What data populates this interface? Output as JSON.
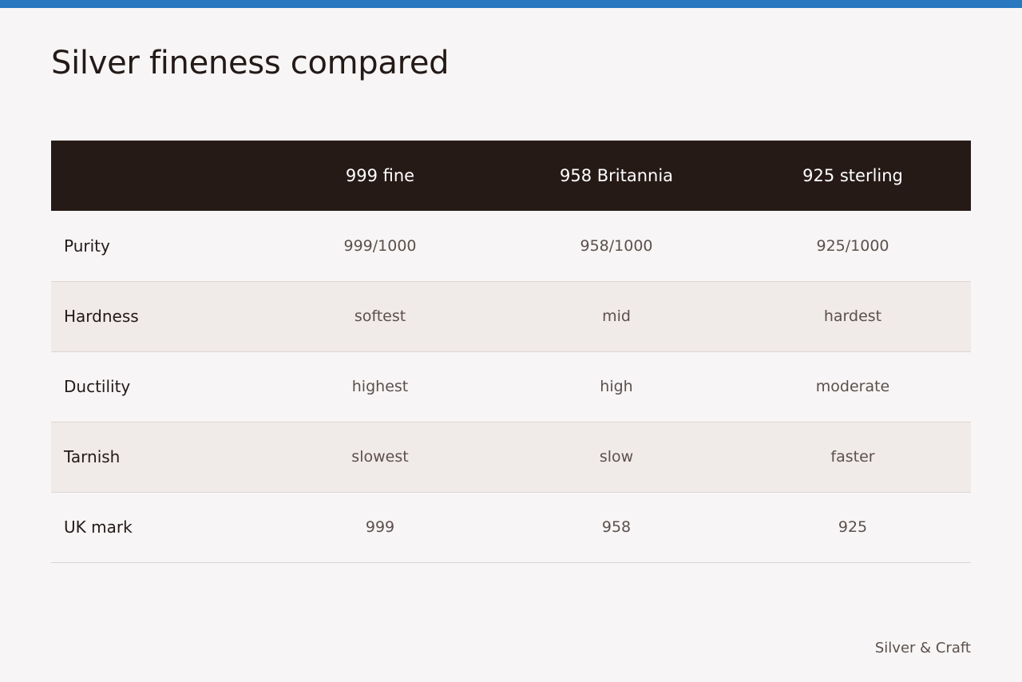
{
  "colors": {
    "accent_bar": "#2878bf",
    "header_bg": "#261a17",
    "alt_row_bg": "#f0eae9",
    "page_bg": "#f7f5f5"
  },
  "title": "Silver fineness compared",
  "table": {
    "headers": [
      "",
      "999 fine",
      "958 Britannia",
      "925 sterling"
    ],
    "rows": [
      {
        "label": "Purity",
        "values": [
          "999/1000",
          "958/1000",
          "925/1000"
        ]
      },
      {
        "label": "Hardness",
        "values": [
          "softest",
          "mid",
          "hardest"
        ]
      },
      {
        "label": "Ductility",
        "values": [
          "highest",
          "high",
          "moderate"
        ]
      },
      {
        "label": "Tarnish",
        "values": [
          "slowest",
          "slow",
          "faster"
        ]
      },
      {
        "label": "UK mark",
        "values": [
          "999",
          "958",
          "925"
        ]
      }
    ]
  },
  "footer": {
    "brand": "Silver & Craft"
  }
}
